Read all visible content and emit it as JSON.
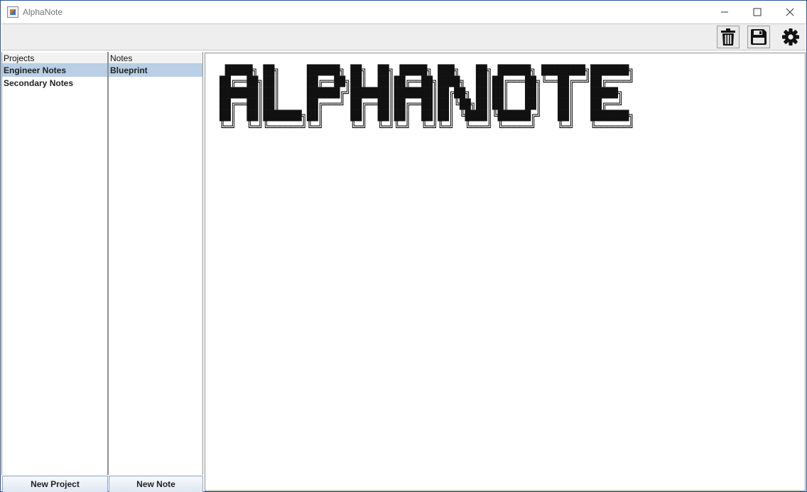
{
  "window": {
    "title": "AlphaNote"
  },
  "toolbar": {
    "delete_icon": "trash-icon",
    "save_icon": "floppy-disk-icon",
    "settings_icon": "gear-icon"
  },
  "projects": {
    "header": "Projects",
    "items": [
      {
        "label": "Engineer Notes",
        "selected": true
      },
      {
        "label": "Secondary Notes",
        "selected": false
      }
    ],
    "new_button": "New Project"
  },
  "notes": {
    "header": "Notes",
    "items": [
      {
        "label": "Blueprint",
        "selected": true
      }
    ],
    "new_button": "New Note"
  },
  "editor": {
    "content": " █████╗ ██╗     ██████╗ ██╗  ██╗ █████╗ ███╗   ██╗ ██████╗ ████████╗███████╗\n██╔══██╗██║     ██╔══██╗██║  ██║██╔══██╗████╗  ██║██╔═══██╗╚══██╔══╝██╔════╝\n███████║██║     ██████╔╝███████║███████║██╔██╗ ██║██║   ██║   ██║   █████╗  \n██╔══██║██║     ██╔═══╝ ██╔══██║██╔══██║██║╚██╗██║██║   ██║   ██║   ██╔══╝  \n██║  ██║███████╗██║     ██║  ██║██║  ██║██║ ╚████║╚██████╔╝   ██║   ███████╗\n╚═╝  ╚═╝╚══════╝╚═╝     ╚═╝  ╚═╝╚═╝  ╚═╝╚═╝  ╚═══╝ ╚═════╝    ╚═╝   ╚══════╝"
  },
  "colors": {
    "selection": "#b8cfe5",
    "window_border": "#2b579a",
    "toolbar_bg": "#eeeeee"
  }
}
